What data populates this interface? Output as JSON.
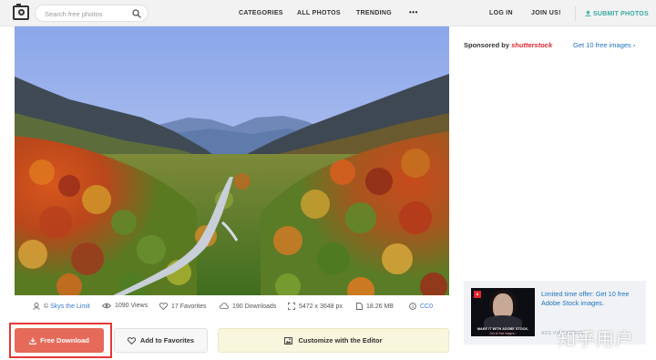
{
  "header": {
    "search_placeholder": "Search free photos",
    "nav": [
      "CATEGORIES",
      "ALL PHOTOS",
      "TRENDING"
    ],
    "more": "•••",
    "login": "LOG IN",
    "join": "JOIN US!",
    "submit": "SUBMIT PHOTOS"
  },
  "photo": {
    "description_icon": "landscape-photo"
  },
  "meta": {
    "author": "Skys the Limit",
    "author_prefix": "©",
    "views": "1090 Views",
    "favorites": "17 Favorites",
    "downloads": "190 Downloads",
    "dimensions": "5472 x 3648 px",
    "filesize": "18.26 MB",
    "license": "CC0"
  },
  "actions": {
    "download": "Free Download",
    "favorite": "Add to Favorites",
    "editor": "Customize with the Editor"
  },
  "sidebar": {
    "sponsored_prefix": "Sponsored by",
    "sponsor_brand": "shutterstock",
    "get_free": "Get 10 free images",
    "ad_text": "Limited time offer: Get 10 free Adobe Stock images.",
    "ad_small": "ADS VIA CARBON",
    "ad_thumb_logo": "A",
    "ad_thumb_tagline": "MAKE IT WITH ADOBE STOCK.",
    "ad_thumb_subline": "Get 10 free images ›"
  },
  "watermark": "知乎用户",
  "colors": {
    "accent": "#3aaaa6",
    "download": "#e66a5a",
    "link": "#1e73be",
    "highlight": "#e53935"
  }
}
